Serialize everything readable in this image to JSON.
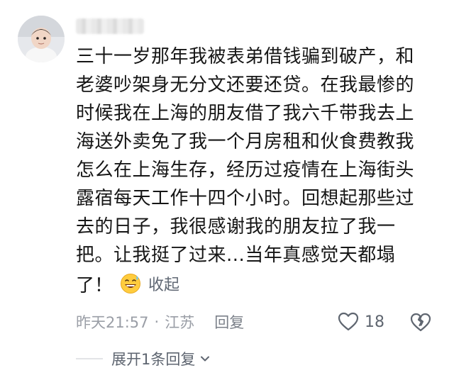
{
  "comment": {
    "lines": [
      "三十一岁那年我被表弟借钱骗到破产，和",
      "老婆吵架身无分文还要还贷。在我最惨的",
      "时候我在上海的朋友借了我六千带我去上",
      "海送外卖免了我一个月房租和伙食费教我",
      "怎么在上海生存，经历过疫情在上海街头",
      "露宿每天工作十四个小时。回想起那些过",
      "去的日子，我很感谢我的朋友拉了我一",
      "把。让我挺了过来...当年真感觉天都塌"
    ],
    "last_line": "了！",
    "emoji": "sweat-smile-emoji",
    "collapse_label": "收起"
  },
  "meta": {
    "time": "昨天21:57",
    "separator": "·",
    "location": "江苏",
    "reply_label": "回复"
  },
  "actions": {
    "like_count": "18",
    "like_icon": "heart-outline-icon",
    "dislike_icon": "broken-heart-icon"
  },
  "replies": {
    "expand_label": "展开1条回复"
  },
  "colors": {
    "text": "#161616",
    "meta": "#9a9ea6",
    "action": "#5f6670"
  }
}
